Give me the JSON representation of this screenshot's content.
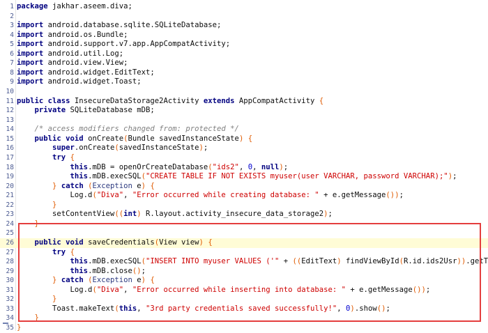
{
  "editor": {
    "lines": [
      {
        "n": "1",
        "tokens": [
          {
            "t": "package",
            "c": "kw"
          },
          {
            "t": " jakhar.aseem.diva;"
          }
        ]
      },
      {
        "n": "2",
        "tokens": []
      },
      {
        "n": "3",
        "tokens": [
          {
            "t": "import",
            "c": "kw"
          },
          {
            "t": " android.database.sqlite.SQLiteDatabase;"
          }
        ]
      },
      {
        "n": "4",
        "tokens": [
          {
            "t": "import",
            "c": "kw"
          },
          {
            "t": " android.os.Bundle;"
          }
        ]
      },
      {
        "n": "5",
        "tokens": [
          {
            "t": "import",
            "c": "kw"
          },
          {
            "t": " android.support.v7.app.AppCompatActivity;"
          }
        ]
      },
      {
        "n": "6",
        "tokens": [
          {
            "t": "import",
            "c": "kw"
          },
          {
            "t": " android.util.Log;"
          }
        ]
      },
      {
        "n": "7",
        "tokens": [
          {
            "t": "import",
            "c": "kw"
          },
          {
            "t": " android.view.View;"
          }
        ]
      },
      {
        "n": "8",
        "tokens": [
          {
            "t": "import",
            "c": "kw"
          },
          {
            "t": " android.widget.EditText;"
          }
        ]
      },
      {
        "n": "9",
        "tokens": [
          {
            "t": "import",
            "c": "kw"
          },
          {
            "t": " android.widget.Toast;"
          }
        ]
      },
      {
        "n": "10",
        "tokens": []
      },
      {
        "n": "11",
        "tokens": [
          {
            "t": "public class",
            "c": "kw"
          },
          {
            "t": " InsecureDataStorage2Activity "
          },
          {
            "t": "extends",
            "c": "kw"
          },
          {
            "t": " AppCompatActivity "
          },
          {
            "t": "{",
            "c": "br"
          }
        ]
      },
      {
        "n": "12",
        "tokens": [
          {
            "t": "    "
          },
          {
            "t": "private",
            "c": "kw"
          },
          {
            "t": " SQLiteDatabase mDB;"
          }
        ]
      },
      {
        "n": "13",
        "tokens": []
      },
      {
        "n": "14",
        "tokens": [
          {
            "t": "    "
          },
          {
            "t": "/* access modifiers changed from: protected */",
            "c": "cm"
          }
        ]
      },
      {
        "n": "15",
        "tokens": [
          {
            "t": "    "
          },
          {
            "t": "public void",
            "c": "kw"
          },
          {
            "t": " onCreate"
          },
          {
            "t": "(",
            "c": "br"
          },
          {
            "t": "Bundle savedInstanceState"
          },
          {
            "t": ")",
            "c": "br"
          },
          {
            "t": " "
          },
          {
            "t": "{",
            "c": "br"
          }
        ]
      },
      {
        "n": "16",
        "tokens": [
          {
            "t": "        "
          },
          {
            "t": "super",
            "c": "kw"
          },
          {
            "t": ".onCreate"
          },
          {
            "t": "(",
            "c": "br"
          },
          {
            "t": "savedInstanceState"
          },
          {
            "t": ")",
            "c": "br"
          },
          {
            "t": ";"
          }
        ]
      },
      {
        "n": "17",
        "tokens": [
          {
            "t": "        "
          },
          {
            "t": "try",
            "c": "kw"
          },
          {
            "t": " "
          },
          {
            "t": "{",
            "c": "br"
          }
        ]
      },
      {
        "n": "18",
        "tokens": [
          {
            "t": "            "
          },
          {
            "t": "this",
            "c": "kw"
          },
          {
            "t": ".mDB = openOrCreateDatabase"
          },
          {
            "t": "(",
            "c": "br"
          },
          {
            "t": "\"ids2\"",
            "c": "str"
          },
          {
            "t": ", "
          },
          {
            "t": "0",
            "c": "num"
          },
          {
            "t": ", "
          },
          {
            "t": "null",
            "c": "kw"
          },
          {
            "t": ")",
            "c": "br"
          },
          {
            "t": ";"
          }
        ]
      },
      {
        "n": "19",
        "tokens": [
          {
            "t": "            "
          },
          {
            "t": "this",
            "c": "kw"
          },
          {
            "t": ".mDB.execSQL"
          },
          {
            "t": "(",
            "c": "br"
          },
          {
            "t": "\"CREATE TABLE IF NOT EXISTS myuser(user VARCHAR, password VARCHAR);\"",
            "c": "str"
          },
          {
            "t": ")",
            "c": "br"
          },
          {
            "t": ";"
          }
        ]
      },
      {
        "n": "20",
        "tokens": [
          {
            "t": "        "
          },
          {
            "t": "}",
            "c": "br"
          },
          {
            "t": " "
          },
          {
            "t": "catch",
            "c": "kw"
          },
          {
            "t": " "
          },
          {
            "t": "(",
            "c": "br"
          },
          {
            "t": "Exception",
            "c": "ty"
          },
          {
            "t": " e"
          },
          {
            "t": ")",
            "c": "br"
          },
          {
            "t": " "
          },
          {
            "t": "{",
            "c": "br"
          }
        ]
      },
      {
        "n": "21",
        "tokens": [
          {
            "t": "            Log.d"
          },
          {
            "t": "(",
            "c": "br"
          },
          {
            "t": "\"Diva\"",
            "c": "str"
          },
          {
            "t": ", "
          },
          {
            "t": "\"Error occurred while creating database: \"",
            "c": "str"
          },
          {
            "t": " + e.getMessage"
          },
          {
            "t": "()",
            "c": "br"
          },
          {
            "t": ")",
            "c": "br"
          },
          {
            "t": ";"
          }
        ]
      },
      {
        "n": "22",
        "tokens": [
          {
            "t": "        "
          },
          {
            "t": "}",
            "c": "br"
          }
        ]
      },
      {
        "n": "23",
        "tokens": [
          {
            "t": "        setContentView"
          },
          {
            "t": "((",
            "c": "br"
          },
          {
            "t": "int",
            "c": "kw"
          },
          {
            "t": ")",
            "c": "br"
          },
          {
            "t": " R.layout.activity_insecure_data_storage2"
          },
          {
            "t": ")",
            "c": "br"
          },
          {
            "t": ";"
          }
        ]
      },
      {
        "n": "24",
        "tokens": [
          {
            "t": "    "
          },
          {
            "t": "}",
            "c": "br"
          }
        ]
      },
      {
        "n": "25",
        "tokens": []
      },
      {
        "n": "26",
        "tokens": [
          {
            "t": "    "
          },
          {
            "t": "public void",
            "c": "kw"
          },
          {
            "t": " saveCredentials"
          },
          {
            "t": "(",
            "c": "br"
          },
          {
            "t": "View view"
          },
          {
            "t": ")",
            "c": "br"
          },
          {
            "t": " "
          },
          {
            "t": "{",
            "c": "br"
          }
        ]
      },
      {
        "n": "27",
        "tokens": [
          {
            "t": "        "
          },
          {
            "t": "try",
            "c": "kw"
          },
          {
            "t": " "
          },
          {
            "t": "{",
            "c": "br"
          }
        ]
      },
      {
        "n": "28",
        "tokens": [
          {
            "t": "            "
          },
          {
            "t": "this",
            "c": "kw"
          },
          {
            "t": ".mDB.execSQL"
          },
          {
            "t": "(",
            "c": "br"
          },
          {
            "t": "\"INSERT INTO myuser VALUES ('\"",
            "c": "str"
          },
          {
            "t": " + "
          },
          {
            "t": "((",
            "c": "br"
          },
          {
            "t": "EditText"
          },
          {
            "t": ")",
            "c": "br"
          },
          {
            "t": " findViewById"
          },
          {
            "t": "(",
            "c": "br"
          },
          {
            "t": "R.id.ids2Usr"
          },
          {
            "t": "))",
            "c": "br"
          },
          {
            "t": ".getText"
          }
        ]
      },
      {
        "n": "29",
        "tokens": [
          {
            "t": "            "
          },
          {
            "t": "this",
            "c": "kw"
          },
          {
            "t": ".mDB.close"
          },
          {
            "t": "()",
            "c": "br"
          },
          {
            "t": ";"
          }
        ]
      },
      {
        "n": "30",
        "tokens": [
          {
            "t": "        "
          },
          {
            "t": "}",
            "c": "br"
          },
          {
            "t": " "
          },
          {
            "t": "catch",
            "c": "kw"
          },
          {
            "t": " "
          },
          {
            "t": "(",
            "c": "br"
          },
          {
            "t": "Exception",
            "c": "ty"
          },
          {
            "t": " e"
          },
          {
            "t": ")",
            "c": "br"
          },
          {
            "t": " "
          },
          {
            "t": "{",
            "c": "br"
          }
        ]
      },
      {
        "n": "31",
        "tokens": [
          {
            "t": "            Log.d"
          },
          {
            "t": "(",
            "c": "br"
          },
          {
            "t": "\"Diva\"",
            "c": "str"
          },
          {
            "t": ", "
          },
          {
            "t": "\"Error occurred while inserting into database: \"",
            "c": "str"
          },
          {
            "t": " + e.getMessage"
          },
          {
            "t": "()",
            "c": "br"
          },
          {
            "t": ")",
            "c": "br"
          },
          {
            "t": ";"
          }
        ]
      },
      {
        "n": "32",
        "tokens": [
          {
            "t": "        "
          },
          {
            "t": "}",
            "c": "br"
          }
        ]
      },
      {
        "n": "33",
        "tokens": [
          {
            "t": "        Toast.makeText"
          },
          {
            "t": "(",
            "c": "br"
          },
          {
            "t": "this",
            "c": "kw"
          },
          {
            "t": ", "
          },
          {
            "t": "\"3rd party credentials saved successfully!\"",
            "c": "str"
          },
          {
            "t": ", "
          },
          {
            "t": "0",
            "c": "num"
          },
          {
            "t": ")",
            "c": "br"
          },
          {
            "t": ".show"
          },
          {
            "t": "()",
            "c": "br"
          },
          {
            "t": ";"
          }
        ]
      },
      {
        "n": "34",
        "tokens": [
          {
            "t": "    "
          },
          {
            "t": "}",
            "c": "br"
          }
        ]
      },
      {
        "n": "35",
        "tokens": [
          {
            "t": "}",
            "c": "br"
          }
        ]
      }
    ],
    "highlighted_line": "26"
  },
  "colors": {
    "keyword": "#000080",
    "string": "#ce0000",
    "number": "#0000d0",
    "comment": "#808080",
    "bracket": "#e05a00",
    "line_number": "#4b5a91",
    "current_line": "#fffcd6",
    "annotation_box": "#e43d3d"
  }
}
